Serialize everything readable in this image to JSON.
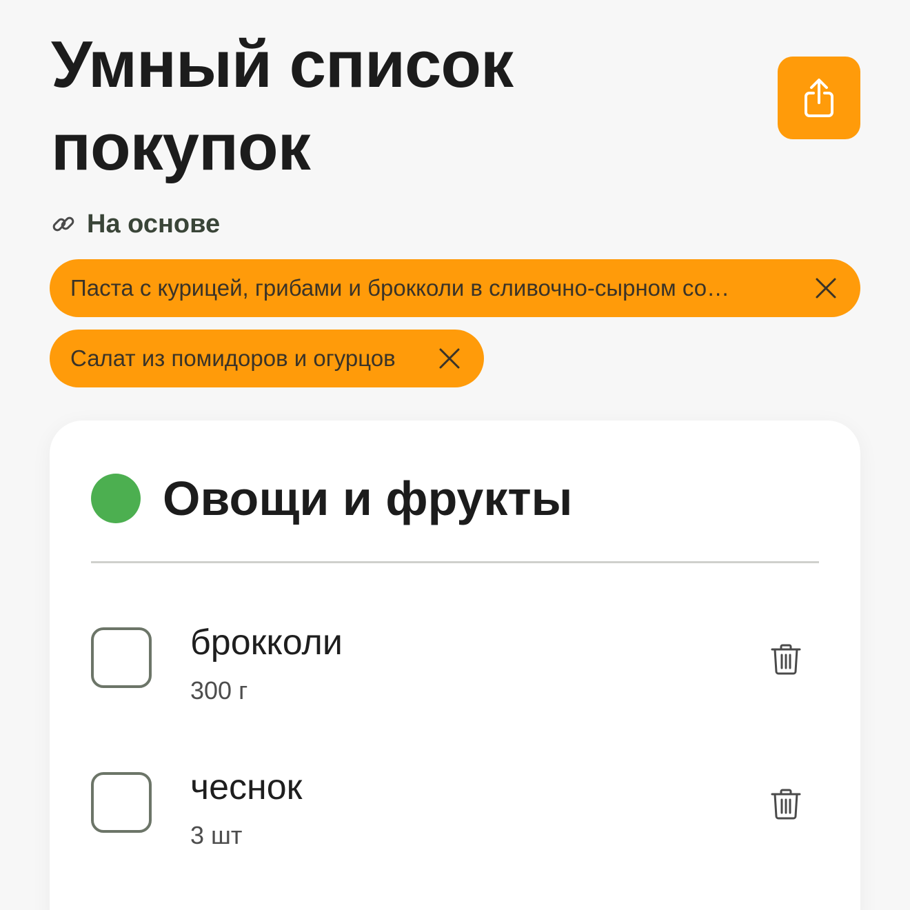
{
  "header": {
    "title": "Умный список покупок",
    "share_icon": "share-icon"
  },
  "based_on": {
    "icon": "link-icon",
    "label": "На основе"
  },
  "recipes": [
    {
      "label": "Паста с курицей, грибами и брокколи в сливочно-сырном со…",
      "close_icon": "close-icon"
    },
    {
      "label": "Салат из помидоров и огурцов",
      "close_icon": "close-icon"
    }
  ],
  "category": {
    "title": "Овощи и фрукты",
    "dot_color": "#4caf50",
    "items": [
      {
        "name": "брокколи",
        "quantity": "300 г",
        "checked": false,
        "delete_icon": "trash-icon"
      },
      {
        "name": "чеснок",
        "quantity": "3 шт",
        "checked": false,
        "delete_icon": "trash-icon"
      }
    ]
  },
  "colors": {
    "accent": "#ff9b0a",
    "background": "#f7f7f7",
    "card": "#ffffff"
  }
}
